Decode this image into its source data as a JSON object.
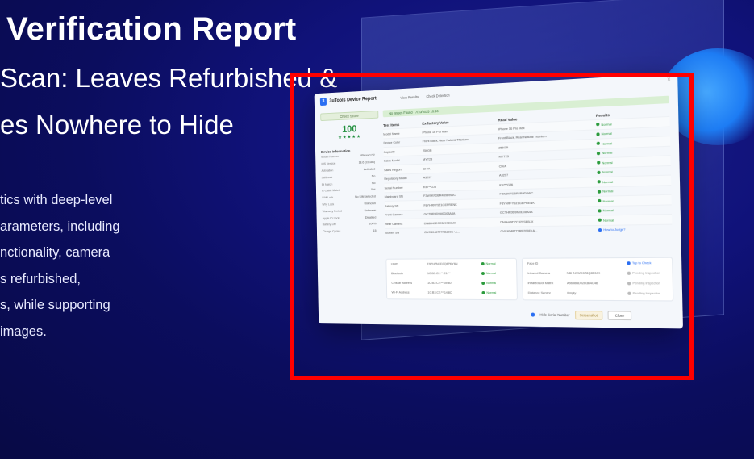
{
  "hero": {
    "headline": " Verification Report",
    "sub1": "Scan: Leaves Refurbished &",
    "sub2": "es Nowhere to Hide",
    "para": [
      "tics with deep-level",
      "arameters, including",
      "nctionality, camera",
      "s refurbished,",
      "s, while supporting",
      " images."
    ]
  },
  "window": {
    "title": "3uTools Device Report",
    "tabs": [
      "View Results",
      "Check Detection"
    ],
    "close": "×",
    "check_button": "Check Score",
    "score": "100",
    "stars": "★★★★★",
    "banner": "No Issues Found  ·  7/10/2025 16:56",
    "device_info": {
      "title": "Device Information",
      "rows": [
        {
          "k": "Model Number",
          "v": "iPhone17,2"
        },
        {
          "k": "iOS Version",
          "v": "18.6 (22G86)"
        },
        {
          "k": "Activation",
          "v": "Activated"
        },
        {
          "k": "Jailbreak",
          "v": "No"
        },
        {
          "k": "Bt Match",
          "v": "No"
        },
        {
          "k": "Is Cable Match",
          "v": "Yes"
        },
        {
          "k": "SIM Lock",
          "v": "No SIM detected"
        },
        {
          "k": "Why Lock",
          "v": "Unknown"
        },
        {
          "k": "Warranty Period",
          "v": "Unknown"
        },
        {
          "k": "Apple ID Lock",
          "v": "Disabled"
        },
        {
          "k": "Battery Life",
          "v": "100%"
        },
        {
          "k": "Charge Cycles",
          "v": "15"
        }
      ]
    },
    "table": {
      "headers": [
        "Test Items",
        "Ex-factory Value",
        "Read Value",
        "Results"
      ],
      "rows": [
        {
          "item": "Model Name",
          "factory": "iPhone 16 Pro Max",
          "read": "iPhone 16 Pro Max",
          "result": "Normal"
        },
        {
          "item": "Device Color",
          "factory": "Front Black, Rear Natural Titanium",
          "read": "Front Black, Rear Natural Titanium",
          "result": "Normal"
        },
        {
          "item": "Capacity",
          "factory": "256GB",
          "read": "256GB",
          "result": "Normal"
        },
        {
          "item": "Sales Model",
          "factory": "MYT23",
          "read": "MYT23",
          "result": "Normal"
        },
        {
          "item": "Sales Region",
          "factory": "CH/A",
          "read": "CH/A",
          "result": "Normal"
        },
        {
          "item": "Regulatory Model",
          "factory": "A3297",
          "read": "A3297",
          "result": "Normal"
        },
        {
          "item": "Serial Number",
          "factory": "K57**GJ6",
          "read": "K57**GJ6",
          "result": "Normal"
        },
        {
          "item": "Mainboard SN",
          "factory": "F3W9KFDBR4B9D9WC",
          "read": "F3W9KFDBR4B9D9WC",
          "result": "Normal"
        },
        {
          "item": "Battery SN",
          "factory": "F8YHRFY9Z1GEPRENK",
          "read": "F8YHRFY9Z1GEPRENK",
          "result": "Normal"
        },
        {
          "item": "Front Camera",
          "factory": "GCTHR0D9M0D08A4A",
          "read": "GCTHR0D9M0D08A4A",
          "result": "Normal"
        },
        {
          "item": "Rear Camera",
          "factory": "DN8H49D7C329SEBJX",
          "read": "DN8H49D7C329SEBJX",
          "result": "Normal"
        },
        {
          "item": "Screen SN",
          "factory": "GVC4048777RB209E+A...",
          "read": "GVC4048777RB209E+A...",
          "result": "How to Judge?"
        }
      ]
    },
    "box_left": [
      {
        "k": "UDID",
        "v": "F9PHZNKD3Q6PKY6N",
        "r": "Normal"
      },
      {
        "k": "Bluetooth",
        "v": "1C:B3:C2:**:E1:**",
        "r": "Normal"
      },
      {
        "k": "Cellular Address",
        "v": "1C:B3:C2:**:39:80",
        "r": "Normal"
      },
      {
        "k": "Wi-Fi Address",
        "v": "1C:B3:C2:**:14:8C",
        "r": "Normal"
      }
    ],
    "box_right": [
      {
        "k": "Face ID",
        "v": "",
        "r": "Tap to Check"
      },
      {
        "k": "Infrared Camera",
        "v": "NBHN7WD0Z8Q8B34K",
        "r": "Pending Inspection"
      },
      {
        "k": "Infrared Dot Matrix",
        "v": "A5698BD02D3B4C4B",
        "r": "Pending Inspection"
      },
      {
        "k": "Distance Sensor",
        "v": "Empty",
        "r": "Pending Inspection"
      }
    ],
    "footer": {
      "hide_serial": "Hide Serial Number",
      "screenshot": "Screenshot",
      "close": "Close"
    }
  },
  "colors": {
    "background": "#0b0d5e",
    "highlight": "#ff0000",
    "ok": "#2b9b3c",
    "accent": "#2a6ef2"
  }
}
